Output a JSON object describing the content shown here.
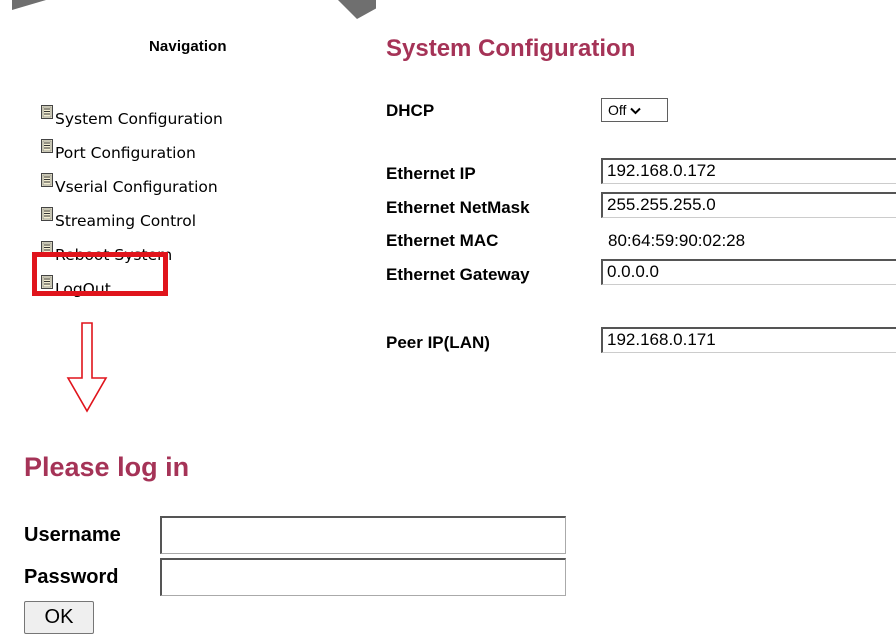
{
  "navigation": {
    "title": "Navigation",
    "items": [
      {
        "label": "System Configuration",
        "icon": "document-icon"
      },
      {
        "label": "Port Configuration",
        "icon": "document-icon"
      },
      {
        "label": "Vserial Configuration",
        "icon": "document-icon"
      },
      {
        "label": "Streaming Control",
        "icon": "document-icon"
      },
      {
        "label": "Reboot System",
        "icon": "document-icon"
      },
      {
        "label": "LogOut",
        "icon": "document-icon"
      }
    ],
    "highlighted_item": "LogOut",
    "annotation_color": "#e0141c"
  },
  "system_config": {
    "title": "System Configuration",
    "title_color": "#a53357",
    "dhcp": {
      "label": "DHCP",
      "value": "Off"
    },
    "ethernet_ip": {
      "label": "Ethernet IP",
      "value": "192.168.0.172"
    },
    "ethernet_netmask": {
      "label": "Ethernet NetMask",
      "value": "255.255.255.0"
    },
    "ethernet_mac": {
      "label": "Ethernet MAC",
      "value": "80:64:59:90:02:28"
    },
    "ethernet_gateway": {
      "label": "Ethernet Gateway",
      "value": "0.0.0.0"
    },
    "peer_ip": {
      "label": "Peer IP(LAN)",
      "value": "192.168.0.171"
    }
  },
  "login": {
    "title": "Please log in",
    "title_color": "#a53357",
    "username_label": "Username",
    "username_value": "",
    "password_label": "Password",
    "password_value": "",
    "ok_label": "OK"
  }
}
